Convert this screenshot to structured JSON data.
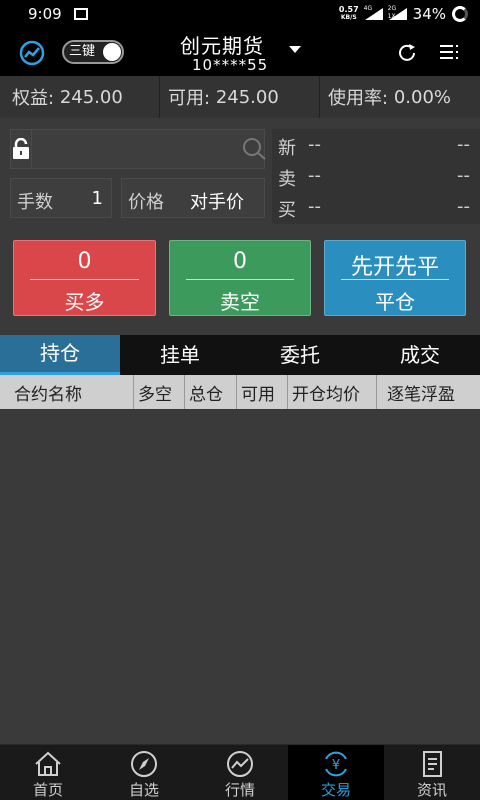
{
  "status_bar": {
    "time": "9:09",
    "net_speed": "0.57",
    "net_unit": "KB/S",
    "sig1": "4G",
    "sig2": "2G",
    "sig2_sub": "1X",
    "battery": "34%"
  },
  "header": {
    "toggle_label": "三键",
    "title": "创元期货",
    "account": "10****55"
  },
  "summary": {
    "equity_label": "权益:",
    "equity_value": "245.00",
    "available_label": "可用:",
    "available_value": "245.00",
    "usage_label": "使用率:",
    "usage_value": "0.00%"
  },
  "order": {
    "search_placeholder": "",
    "qty_label": "手数",
    "qty_value": "1",
    "price_label": "价格",
    "price_value": "对手价"
  },
  "quote": {
    "rows": [
      {
        "label": "新",
        "v1": "--",
        "v2": "--"
      },
      {
        "label": "卖",
        "v1": "--",
        "v2": "--"
      },
      {
        "label": "买",
        "v1": "--",
        "v2": "--"
      }
    ]
  },
  "actions": {
    "buy_top": "0",
    "buy_bottom": "买多",
    "sell_top": "0",
    "sell_bottom": "卖空",
    "close_top": "先开先平",
    "close_bottom": "平仓"
  },
  "tabs": [
    "持仓",
    "挂单",
    "委托",
    "成交"
  ],
  "table_header": [
    "合约名称",
    "多空",
    "总仓",
    "可用",
    "开仓均价",
    "逐笔浮盈"
  ],
  "bottom_nav": [
    "首页",
    "自选",
    "行情",
    "交易",
    "资讯"
  ],
  "colors": {
    "buy": "#d9474b",
    "sell": "#3c9a5c",
    "close": "#2a8fbf",
    "accent": "#2fa0e0"
  }
}
